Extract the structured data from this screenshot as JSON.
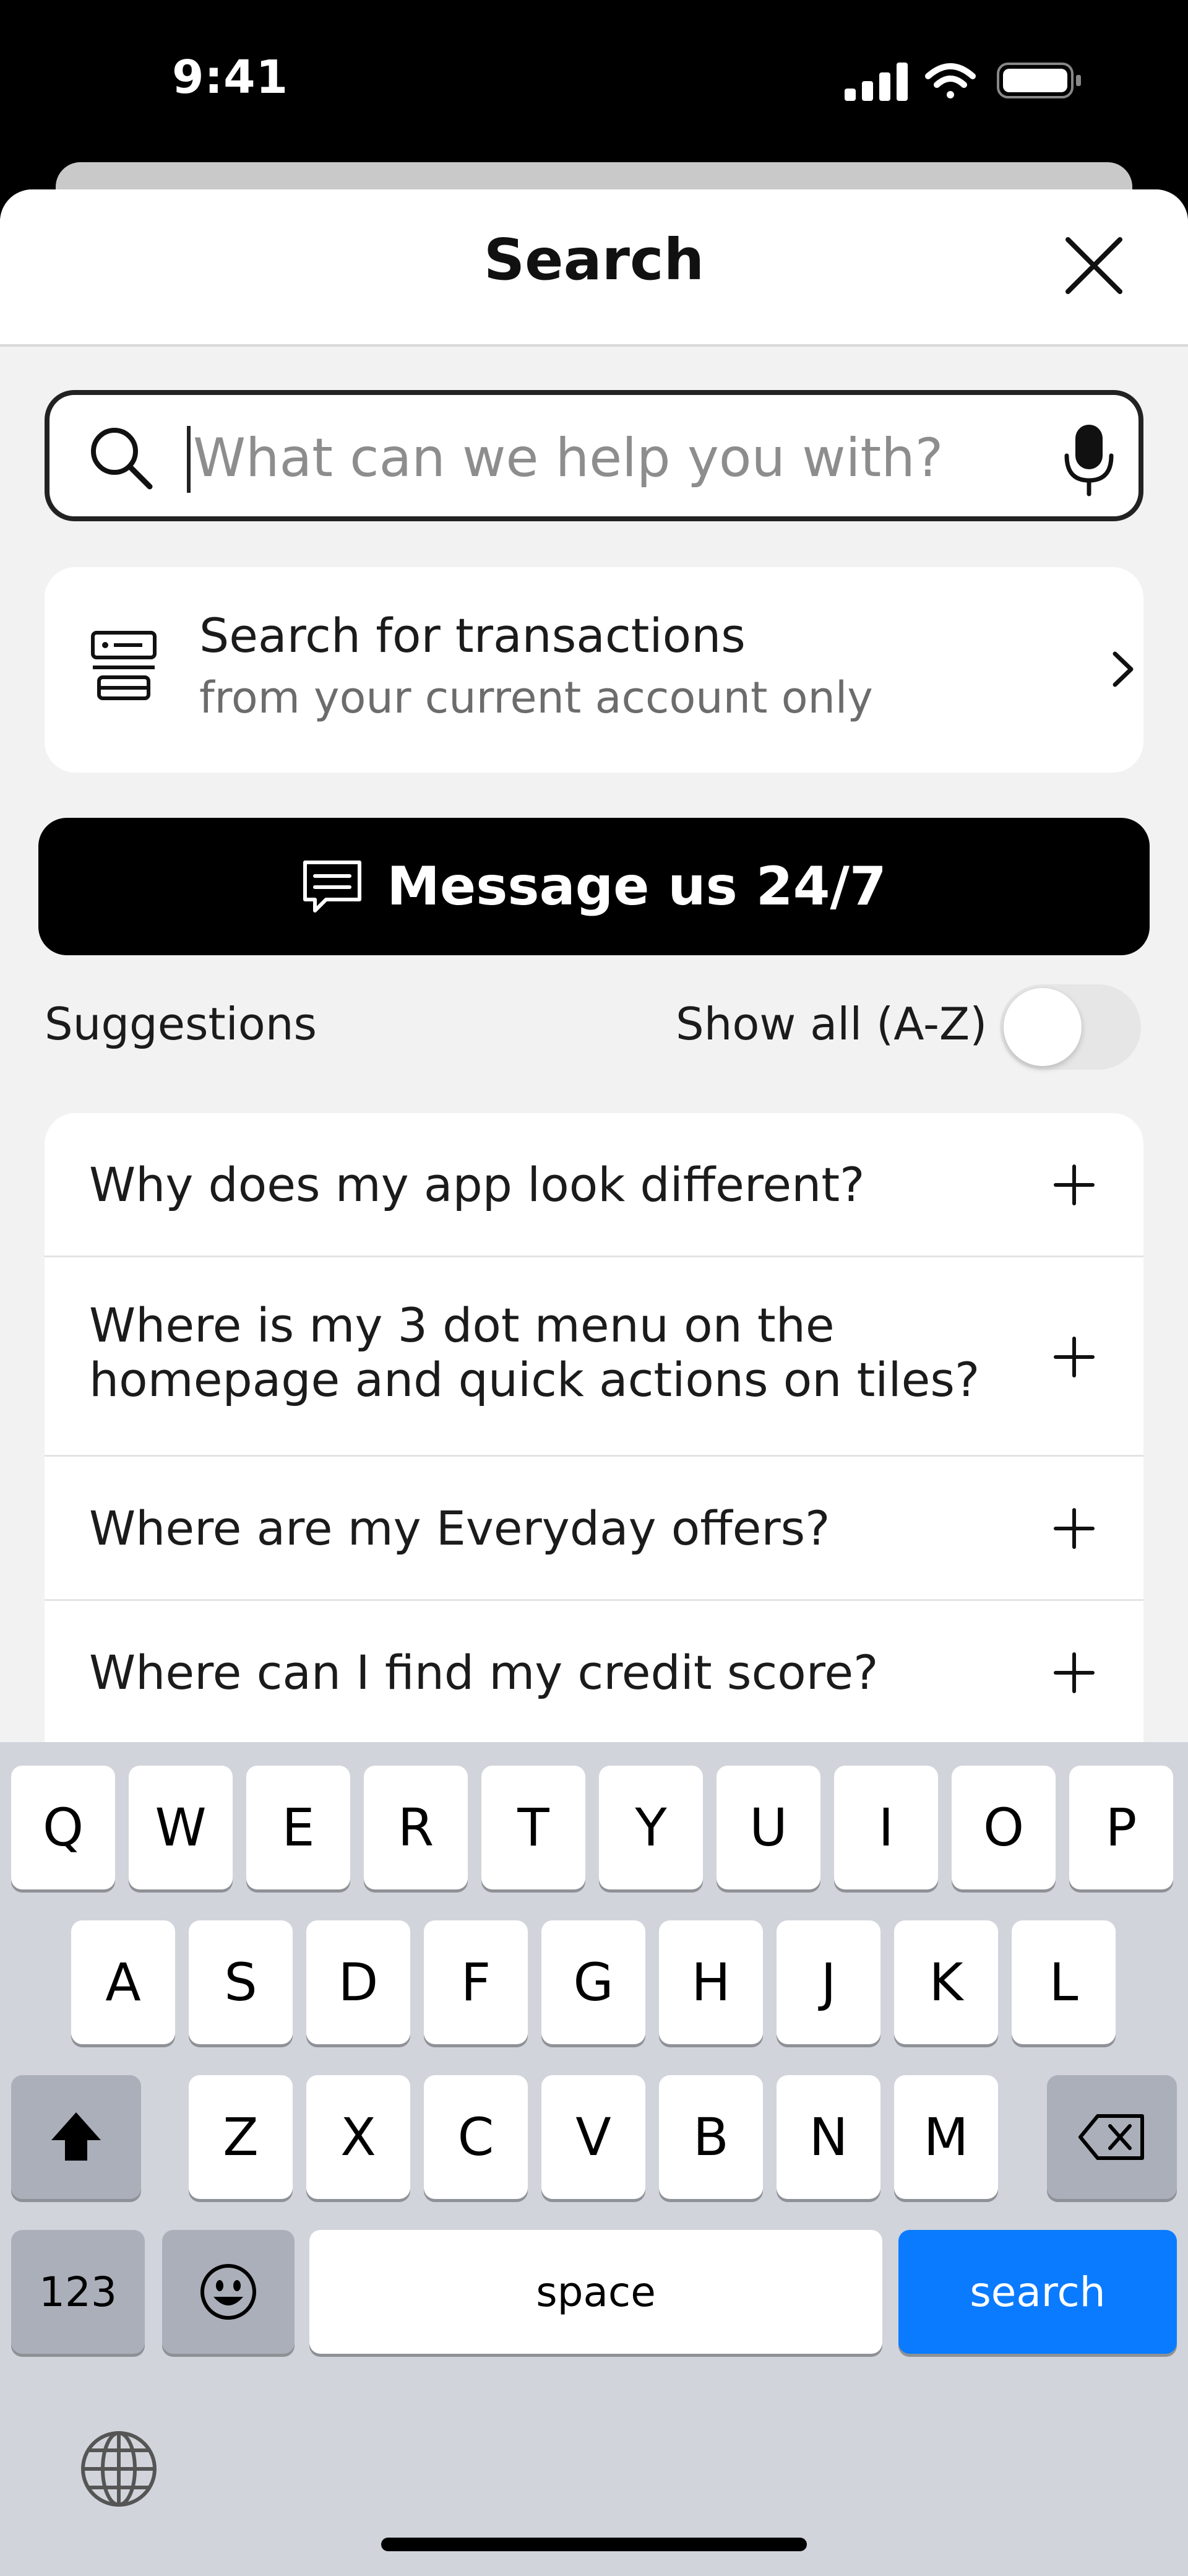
{
  "status_bar": {
    "time": "9:41"
  },
  "header": {
    "title": "Search"
  },
  "search": {
    "placeholder": "What can we help you with?"
  },
  "transactions": {
    "title": "Search for transactions",
    "subtitle": "from your current account only"
  },
  "message_button": {
    "label": "Message us 24/7"
  },
  "suggestions": {
    "label": "Suggestions",
    "show_all_label": "Show all (A-Z)",
    "show_all_on": false
  },
  "faqs": [
    {
      "line1": "Why does my app look different?",
      "line2": ""
    },
    {
      "line1": "Where is my 3 dot menu on the",
      "line2": "homepage and quick actions on tiles?"
    },
    {
      "line1": "Where are my Everyday offers?",
      "line2": ""
    },
    {
      "line1": "Where can I find my credit score?",
      "line2": ""
    }
  ],
  "keyboard": {
    "row1": [
      "Q",
      "W",
      "E",
      "R",
      "T",
      "Y",
      "U",
      "I",
      "O",
      "P"
    ],
    "row2": [
      "A",
      "S",
      "D",
      "F",
      "G",
      "H",
      "J",
      "K",
      "L"
    ],
    "row3": [
      "Z",
      "X",
      "C",
      "V",
      "B",
      "N",
      "M"
    ],
    "numbers_label": "123",
    "space_label": "space",
    "search_label": "search"
  },
  "colors": {
    "accent_blue": "#0a7bff",
    "button_black": "#000000",
    "sheet_bg": "#f2f2f2"
  }
}
